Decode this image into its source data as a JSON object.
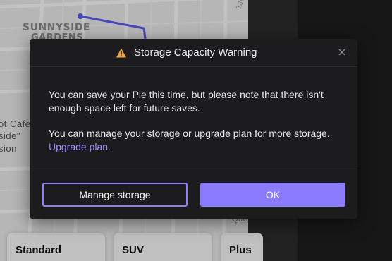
{
  "map": {
    "neighborhood_line1": "SUNNYSIDE",
    "neighborhood_line2": "GARDENS",
    "street": "58th",
    "poi_lines": [
      "ot Cafe",
      "side\"",
      "sion"
    ],
    "partial_label": "Que",
    "route_color": "#5b5bf0"
  },
  "vehicles": [
    {
      "label": "Standard"
    },
    {
      "label": "SUV"
    },
    {
      "label": "Plus"
    }
  ],
  "dialog": {
    "title": "Storage Capacity Warning",
    "icon": "warning-icon",
    "warning_color": "#f0a33a",
    "body_line1": "You can save your Pie this time, but please note that there isn't enough space left for future saves.",
    "body_line2": "You can manage your storage or upgrade plan for more storage.",
    "link_text": "Upgrade plan.",
    "secondary_button": "Manage storage",
    "primary_button": "OK",
    "accent_color": "#8b7bff"
  }
}
